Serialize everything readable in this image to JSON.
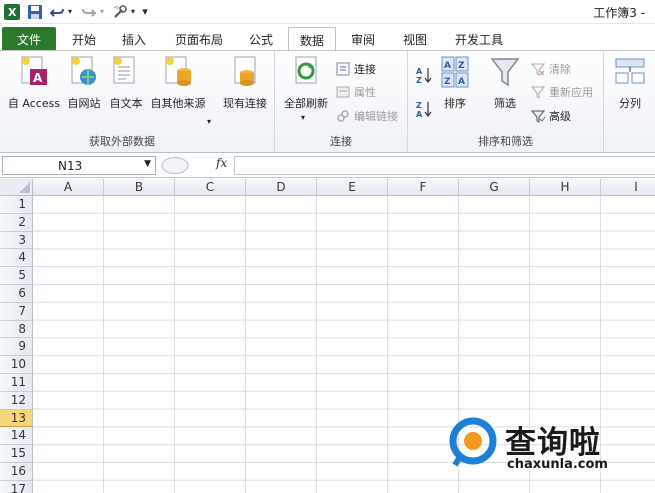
{
  "window": {
    "title": "工作簿3 -"
  },
  "quick_access": {
    "app_icon": "excel-icon",
    "save_icon": "save-icon",
    "undo_icon": "undo-icon",
    "redo_icon": "redo-icon",
    "customize_icon": "customize-icon",
    "more_label": "▾"
  },
  "tabs": [
    {
      "label": "文件"
    },
    {
      "label": "开始"
    },
    {
      "label": "插入"
    },
    {
      "label": "页面布局"
    },
    {
      "label": "公式"
    },
    {
      "label": "数据"
    },
    {
      "label": "审阅"
    },
    {
      "label": "视图"
    },
    {
      "label": "开发工具"
    }
  ],
  "ribbon": {
    "external": {
      "label": "获取外部数据",
      "access": "自 Access",
      "web": "自网站",
      "text": "自文本",
      "other": "自其他来源"
    },
    "existing": {
      "label": "现有连接"
    },
    "connections": {
      "label": "连接",
      "refresh_all": "全部刷新",
      "connections": "连接",
      "properties": "属性",
      "edit_links": "编辑链接"
    },
    "sort_filter": {
      "label": "排序和筛选",
      "sort": "排序",
      "filter": "筛选",
      "clear": "清除",
      "reapply": "重新应用",
      "advanced": "高级"
    },
    "tools": {
      "split": "分列"
    }
  },
  "formula_bar": {
    "namebox_value": "N13",
    "fx_label": "fx",
    "formula_value": ""
  },
  "columns": [
    "A",
    "B",
    "C",
    "D",
    "E",
    "F",
    "G",
    "H",
    "I"
  ],
  "rows": [
    "1",
    "2",
    "3",
    "4",
    "5",
    "6",
    "7",
    "8",
    "9",
    "10",
    "11",
    "12",
    "13",
    "14",
    "15",
    "16",
    "17"
  ],
  "active_row": "13",
  "watermark": {
    "title": "查询啦",
    "url": "chaxunla.com"
  },
  "colors": {
    "file_tab": "#2b7a2b",
    "active_row_header": "#f6d67b",
    "watermark_blue": "#1e7fd8",
    "watermark_orange": "#f39a1e"
  }
}
